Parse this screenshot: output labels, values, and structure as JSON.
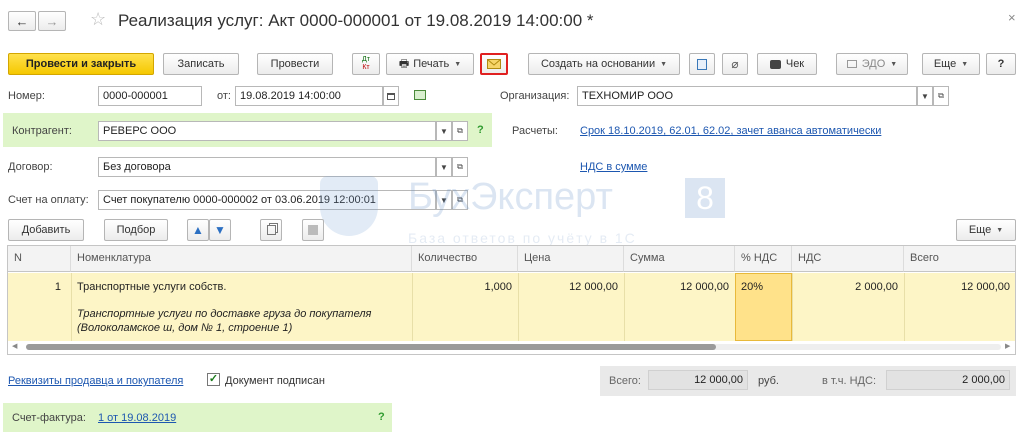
{
  "window": {
    "title": "Реализация услуг: Акт 0000-000001 от 19.08.2019 14:00:00 *",
    "close_glyph": "×"
  },
  "toolbar": {
    "post_close": "Провести и закрыть",
    "save": "Записать",
    "post": "Провести",
    "dt_kt_top": "Дт",
    "dt_kt_bottom": "Кт",
    "print": "Печать",
    "create_basis": "Создать на основании",
    "check": "Чек",
    "edo": "ЭДО",
    "more": "Еще",
    "help": "?"
  },
  "form": {
    "number_label": "Номер:",
    "number_value": "0000-000001",
    "date_label": "от:",
    "date_value": "19.08.2019 14:00:00",
    "org_label": "Организация:",
    "org_value": "ТЕХНОМИР ООО",
    "contractor_label": "Контрагент:",
    "contractor_value": "РЕВЕРС ООО",
    "contractor_help": "?",
    "settlements_label": "Расчеты:",
    "settlements_link": "Срок 18.10.2019, 62.01, 62.02, зачет аванса автоматически",
    "contract_label": "Договор:",
    "contract_value": "Без договора",
    "vat_link": "НДС в сумме",
    "invoice_label": "Счет на оплату:",
    "invoice_value": "Счет покупателю 0000-000002 от 03.06.2019 12:00:01"
  },
  "table_toolbar": {
    "add": "Добавить",
    "pick": "Подбор",
    "more": "Еще"
  },
  "watermark": {
    "title": "БухЭксперт",
    "number": "8",
    "subtitle": "База ответов по учёту в 1С"
  },
  "table": {
    "columns": [
      "N",
      "Номенклатура",
      "Количество",
      "Цена",
      "Сумма",
      "% НДС",
      "НДС",
      "Всего"
    ],
    "rows": [
      {
        "n": "1",
        "item": "Транспортные услуги собств.",
        "content_line1": "Транспортные услуги по доставке груза до покупателя",
        "content_line2": "(Волоколамское ш, дом № 1, строение 1)",
        "qty": "1,000",
        "price": "12 000,00",
        "sum": "12 000,00",
        "vat_rate": "20%",
        "vat": "2 000,00",
        "total": "12 000,00"
      }
    ]
  },
  "footer": {
    "requisites_link": "Реквизиты продавца и покупателя",
    "signed_label": "Документ подписан",
    "total_label": "Всего:",
    "total_value": "12 000,00",
    "currency": "руб.",
    "vat_incl_label": "в т.ч. НДС:",
    "vat_incl_value": "2 000,00",
    "invoice_label": "Счет-фактура:",
    "invoice_link": "1 от 19.08.2019",
    "invoice_help": "?"
  },
  "colors": {
    "accent_yellow": "#f5c800",
    "link_blue": "#1d57b0",
    "green_band": "#dff5c9",
    "row_highlight": "#fdf5c6",
    "active_cell": "#ffe28a",
    "highlight_border": "#e02020"
  }
}
